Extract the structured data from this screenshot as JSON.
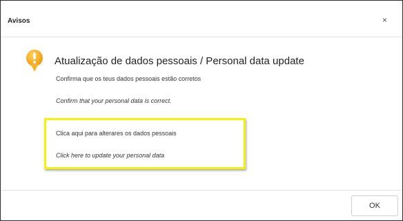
{
  "dialog": {
    "title": "Avisos",
    "close_label": "×",
    "heading": "Atualização de dados pessoais / Personal data update",
    "confirm_pt": "Confirma que os teus dados pessoais estão corretos",
    "confirm_en": "Confirm that your personal data is correct.",
    "update_link_pt": "Clica aqui para alterares os dados pessoais",
    "update_link_en": "Click here to update your personal data",
    "ok_label": "OK"
  },
  "icons": {
    "warning": "warning-icon",
    "close": "close-icon"
  },
  "colors": {
    "highlight": "#f2f20c",
    "warning_icon": "#f5a623"
  }
}
